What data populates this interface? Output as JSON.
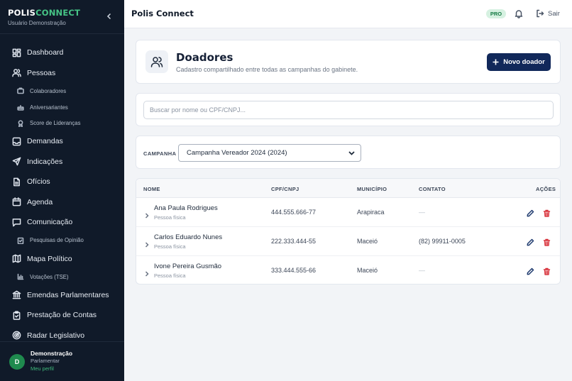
{
  "sidebar": {
    "brand_part1": "POLIS",
    "brand_part2": "CONNECT",
    "brand_sub": "Usuário Demonstração",
    "items": {
      "dashboard": "Dashboard",
      "pessoas": "Pessoas",
      "colaboradores": "Colaboradores",
      "aniversariantes": "Aniversariantes",
      "score": "Score de Lideranças",
      "demandas": "Demandas",
      "indicacoes": "Indicações",
      "oficios": "Ofícios",
      "agenda": "Agenda",
      "comunicacao": "Comunicação",
      "pesquisas": "Pesquisas de Opinião",
      "mapa": "Mapa Político",
      "votacoes": "Votações (TSE)",
      "emendas": "Emendas Parlamentares",
      "prestacao": "Prestação de Contas",
      "radar": "Radar Legislativo"
    },
    "user": {
      "initial": "D",
      "name": "Demonstração",
      "role": "Parlamentar",
      "profile_link": "Meu perfil"
    }
  },
  "topbar": {
    "title": "Polis Connect",
    "badge": "PRO",
    "logout": "Sair"
  },
  "page": {
    "title": "Doadores",
    "subtitle": "Cadastro compartilhado entre todas as campanhas do gabinete.",
    "new_button": "Novo doador",
    "search_placeholder": "Buscar por nome ou CPF/CNPJ...",
    "filter_label": "CAMPANHA",
    "campaign_selected": "Campanha Vereador 2024 (2024)"
  },
  "table": {
    "headers": {
      "nome": "NOME",
      "doc": "CPF/CNPJ",
      "municipio": "MUNICÍPIO",
      "contato": "CONTATO",
      "acoes": "AÇÕES"
    },
    "rows": [
      {
        "name": "Ana Paula Rodrigues",
        "type": "Pessoa física",
        "doc": "444.555.666-77",
        "city": "Arapiraca",
        "contact": "—"
      },
      {
        "name": "Carlos Eduardo Nunes",
        "type": "Pessoa física",
        "doc": "222.333.444-55",
        "city": "Maceió",
        "contact": "(82) 99911-0005"
      },
      {
        "name": "Ivone Pereira Gusmão",
        "type": "Pessoa física",
        "doc": "333.444.555-66",
        "city": "Maceió",
        "contact": "—"
      }
    ]
  },
  "colors": {
    "sidebar_bg": "#101a29",
    "brand_accent": "#46c486",
    "primary_button": "#11285a",
    "delete": "#d8333c"
  },
  "icons": [
    "chevron-left-icon",
    "dashboard-icon",
    "users-icon",
    "briefcase-icon",
    "cake-icon",
    "award-icon",
    "inbox-icon",
    "send-icon",
    "file-icon",
    "calendar-icon",
    "message-icon",
    "map-icon",
    "bar-chart-icon",
    "bank-icon",
    "clipboard-icon",
    "radar-icon",
    "bell-icon",
    "logout-icon",
    "plus-icon",
    "chevron-right-icon",
    "pencil-icon",
    "trash-icon"
  ]
}
